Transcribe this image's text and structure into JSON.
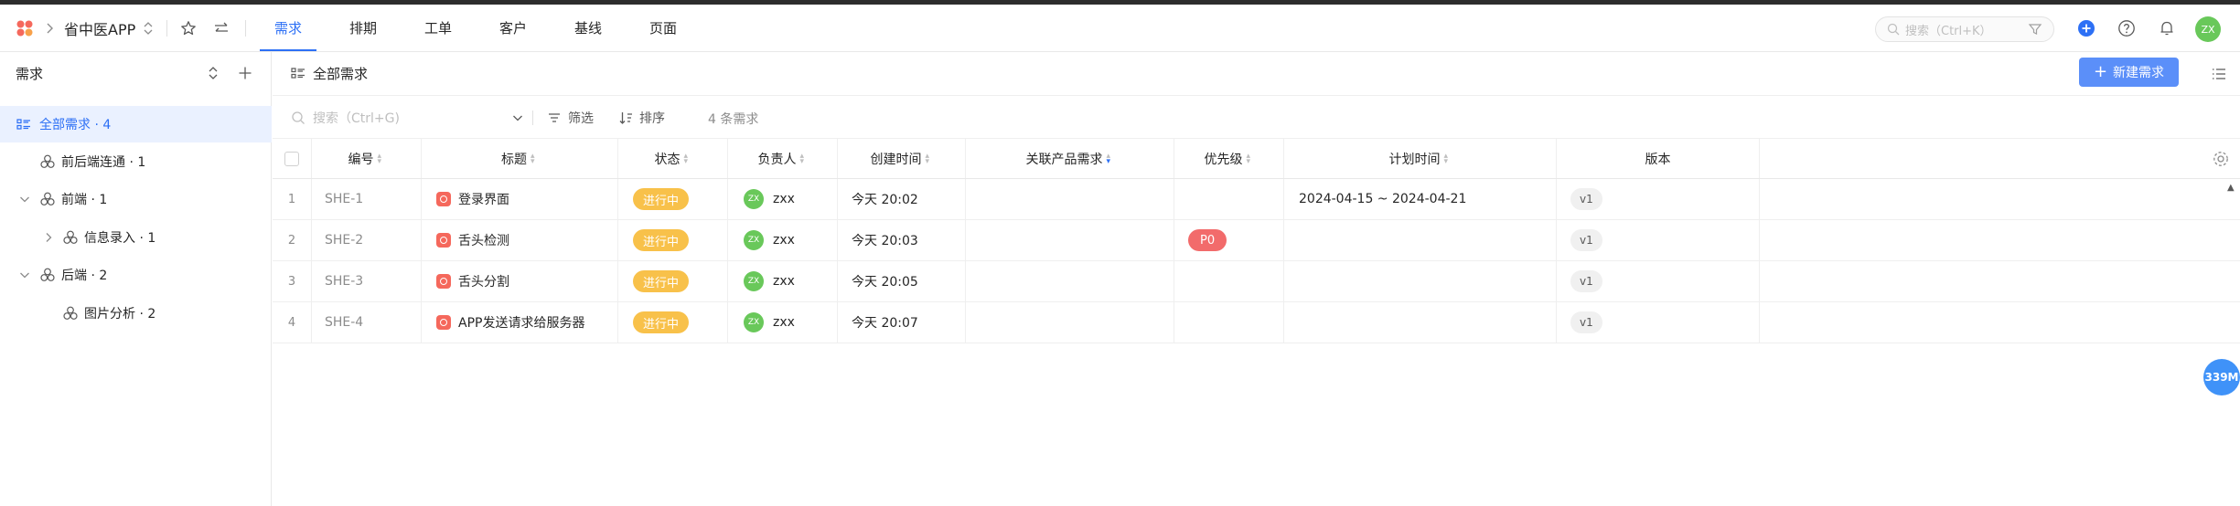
{
  "topbar": {
    "project_name": "省中医APP",
    "tabs": [
      {
        "label": "需求",
        "active": true
      },
      {
        "label": "排期",
        "active": false
      },
      {
        "label": "工单",
        "active": false
      },
      {
        "label": "客户",
        "active": false
      },
      {
        "label": "基线",
        "active": false
      },
      {
        "label": "页面",
        "active": false
      }
    ],
    "search_placeholder": "搜索（Ctrl+K）",
    "user_initials": "ZX"
  },
  "sidebar": {
    "title": "需求",
    "items": [
      {
        "label": "全部需求 · 4",
        "active": true,
        "icon": "list-icon"
      },
      {
        "label": "前后端连通 · 1",
        "icon": "group-icon"
      },
      {
        "label": "前端 · 1",
        "icon": "group-icon",
        "expanded": true
      },
      {
        "label": "信息录入 · 1",
        "icon": "group-icon",
        "collapsed": true
      },
      {
        "label": "后端 · 2",
        "icon": "group-icon",
        "expanded": true
      },
      {
        "label": "图片分析 · 2",
        "icon": "group-icon"
      }
    ]
  },
  "view": {
    "title": "全部需求",
    "new_button": "新建需求"
  },
  "toolbar": {
    "search_placeholder": "搜索（Ctrl+G)",
    "filter": "筛选",
    "sort": "排序",
    "count": "4 条需求"
  },
  "table": {
    "headers": {
      "code": "编号",
      "title": "标题",
      "status": "状态",
      "owner": "负责人",
      "created": "创建时间",
      "related": "关联产品需求",
      "priority": "优先级",
      "plan": "计划时间",
      "version": "版本"
    },
    "rows": [
      {
        "num": "1",
        "code": "SHE-1",
        "title": "登录界面",
        "status": "进行中",
        "owner_initials": "ZX",
        "owner": "zxx",
        "created": "今天 20:02",
        "priority": "",
        "plan": "2024-04-15 ~ 2024-04-21",
        "version": "v1"
      },
      {
        "num": "2",
        "code": "SHE-2",
        "title": "舌头检测",
        "status": "进行中",
        "owner_initials": "ZX",
        "owner": "zxx",
        "created": "今天 20:03",
        "priority": "P0",
        "plan": "",
        "version": "v1"
      },
      {
        "num": "3",
        "code": "SHE-3",
        "title": "舌头分割",
        "status": "进行中",
        "owner_initials": "ZX",
        "owner": "zxx",
        "created": "今天 20:05",
        "priority": "",
        "plan": "",
        "version": "v1"
      },
      {
        "num": "4",
        "code": "SHE-4",
        "title": "APP发送请求给服务器",
        "status": "进行中",
        "owner_initials": "ZX",
        "owner": "zxx",
        "created": "今天 20:07",
        "priority": "",
        "plan": "",
        "version": "v1"
      }
    ]
  },
  "memory_badge": "339M",
  "colors": {
    "accent": "#2d70f5",
    "status_in_progress": "#f8c14a",
    "priority_p0": "#f26b6b",
    "avatar": "#69c85a",
    "new_button": "#5b8ff9"
  }
}
